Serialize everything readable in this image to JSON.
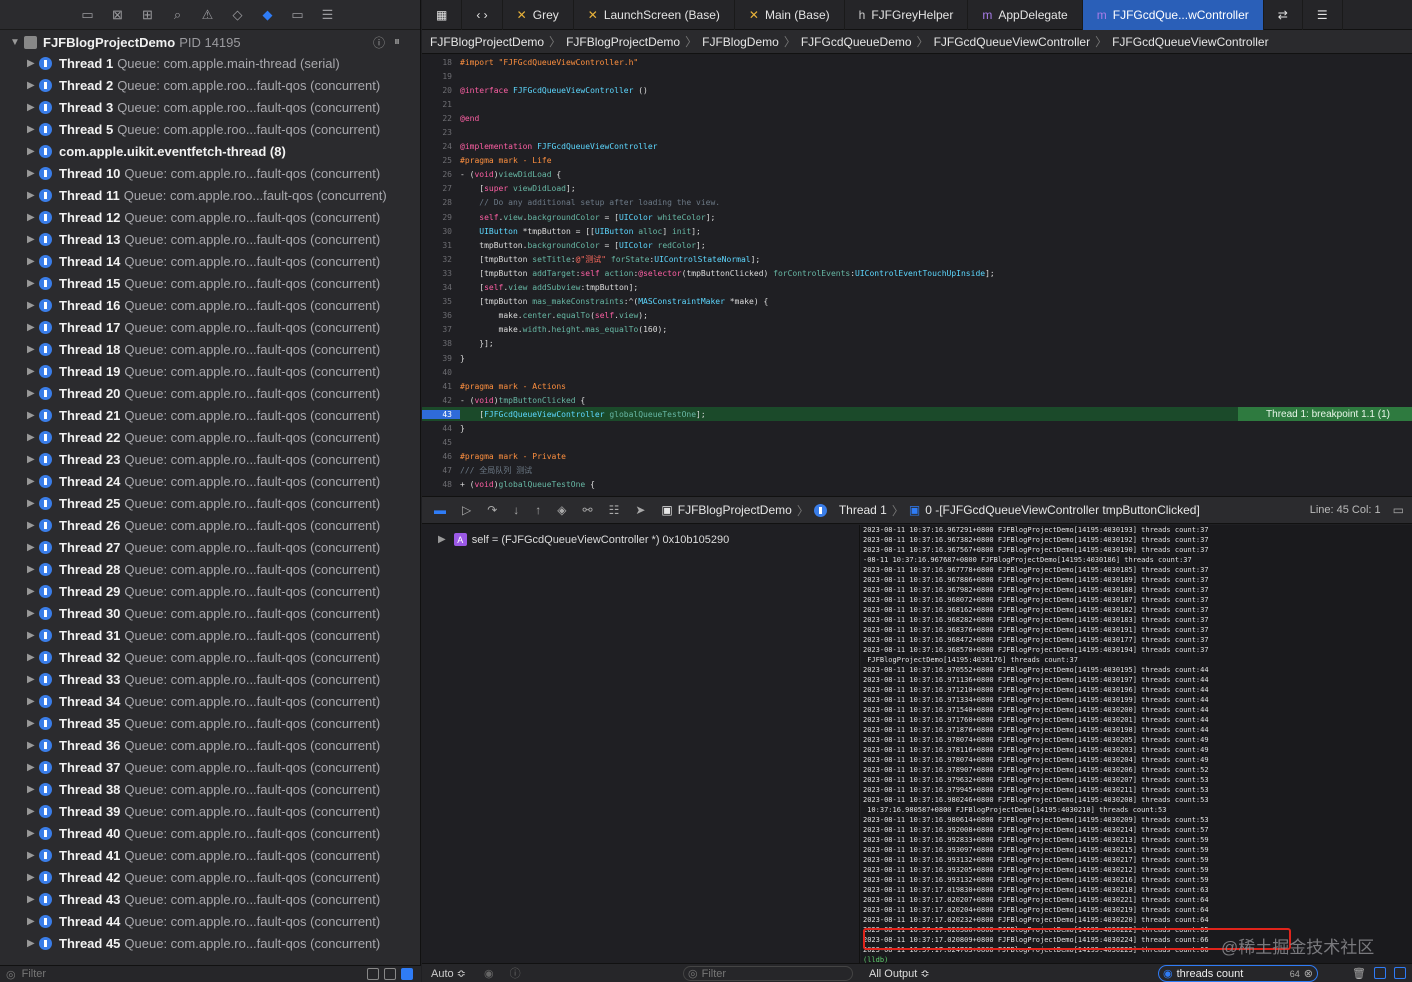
{
  "nav_icons": [
    "folder-icon",
    "xmark-square-icon",
    "hierarchy-icon",
    "search-icon",
    "warning-icon",
    "diamond-icon",
    "debug-navigator-icon",
    "breakpoint-navigator-icon",
    "report-icon"
  ],
  "process": {
    "name": "FJFBlogProjectDemo",
    "pid": "PID 14195"
  },
  "threads": [
    {
      "name": "Thread 1",
      "queue": "Queue: com.apple.main-thread (serial)"
    },
    {
      "name": "Thread 2",
      "queue": "Queue: com.apple.roo...fault-qos (concurrent)"
    },
    {
      "name": "Thread 3",
      "queue": "Queue: com.apple.roo...fault-qos (concurrent)"
    },
    {
      "name": "Thread 5",
      "queue": "Queue: com.apple.roo...fault-qos (concurrent)"
    },
    {
      "name": "com.apple.uikit.eventfetch-thread (8)",
      "queue": ""
    },
    {
      "name": "Thread 10",
      "queue": "Queue: com.apple.ro...fault-qos (concurrent)"
    },
    {
      "name": "Thread 11",
      "queue": "Queue: com.apple.roo...fault-qos (concurrent)"
    },
    {
      "name": "Thread 12",
      "queue": "Queue: com.apple.ro...fault-qos (concurrent)"
    },
    {
      "name": "Thread 13",
      "queue": "Queue: com.apple.ro...fault-qos (concurrent)"
    },
    {
      "name": "Thread 14",
      "queue": "Queue: com.apple.ro...fault-qos (concurrent)"
    },
    {
      "name": "Thread 15",
      "queue": "Queue: com.apple.ro...fault-qos (concurrent)"
    },
    {
      "name": "Thread 16",
      "queue": "Queue: com.apple.ro...fault-qos (concurrent)"
    },
    {
      "name": "Thread 17",
      "queue": "Queue: com.apple.ro...fault-qos (concurrent)"
    },
    {
      "name": "Thread 18",
      "queue": "Queue: com.apple.ro...fault-qos (concurrent)"
    },
    {
      "name": "Thread 19",
      "queue": "Queue: com.apple.ro...fault-qos (concurrent)"
    },
    {
      "name": "Thread 20",
      "queue": "Queue: com.apple.ro...fault-qos (concurrent)"
    },
    {
      "name": "Thread 21",
      "queue": "Queue: com.apple.ro...fault-qos (concurrent)"
    },
    {
      "name": "Thread 22",
      "queue": "Queue: com.apple.ro...fault-qos (concurrent)"
    },
    {
      "name": "Thread 23",
      "queue": "Queue: com.apple.ro...fault-qos (concurrent)"
    },
    {
      "name": "Thread 24",
      "queue": "Queue: com.apple.ro...fault-qos (concurrent)"
    },
    {
      "name": "Thread 25",
      "queue": "Queue: com.apple.ro...fault-qos (concurrent)"
    },
    {
      "name": "Thread 26",
      "queue": "Queue: com.apple.ro...fault-qos (concurrent)"
    },
    {
      "name": "Thread 27",
      "queue": "Queue: com.apple.ro...fault-qos (concurrent)"
    },
    {
      "name": "Thread 28",
      "queue": "Queue: com.apple.ro...fault-qos (concurrent)"
    },
    {
      "name": "Thread 29",
      "queue": "Queue: com.apple.ro...fault-qos (concurrent)"
    },
    {
      "name": "Thread 30",
      "queue": "Queue: com.apple.ro...fault-qos (concurrent)"
    },
    {
      "name": "Thread 31",
      "queue": "Queue: com.apple.ro...fault-qos (concurrent)"
    },
    {
      "name": "Thread 32",
      "queue": "Queue: com.apple.ro...fault-qos (concurrent)"
    },
    {
      "name": "Thread 33",
      "queue": "Queue: com.apple.ro...fault-qos (concurrent)"
    },
    {
      "name": "Thread 34",
      "queue": "Queue: com.apple.ro...fault-qos (concurrent)"
    },
    {
      "name": "Thread 35",
      "queue": "Queue: com.apple.ro...fault-qos (concurrent)"
    },
    {
      "name": "Thread 36",
      "queue": "Queue: com.apple.ro...fault-qos (concurrent)"
    },
    {
      "name": "Thread 37",
      "queue": "Queue: com.apple.ro...fault-qos (concurrent)"
    },
    {
      "name": "Thread 38",
      "queue": "Queue: com.apple.ro...fault-qos (concurrent)"
    },
    {
      "name": "Thread 39",
      "queue": "Queue: com.apple.ro...fault-qos (concurrent)"
    },
    {
      "name": "Thread 40",
      "queue": "Queue: com.apple.ro...fault-qos (concurrent)"
    },
    {
      "name": "Thread 41",
      "queue": "Queue: com.apple.ro...fault-qos (concurrent)"
    },
    {
      "name": "Thread 42",
      "queue": "Queue: com.apple.ro...fault-qos (concurrent)"
    },
    {
      "name": "Thread 43",
      "queue": "Queue: com.apple.ro...fault-qos (concurrent)"
    },
    {
      "name": "Thread 44",
      "queue": "Queue: com.apple.ro...fault-qos (concurrent)"
    },
    {
      "name": "Thread 45",
      "queue": "Queue: com.apple.ro...fault-qos (concurrent)"
    }
  ],
  "left_filter_placeholder": "Filter",
  "tabs": [
    {
      "icon": "✕",
      "label": "Grey",
      "active": false
    },
    {
      "icon": "✕",
      "label": "LaunchScreen (Base)",
      "active": false
    },
    {
      "icon": "✕",
      "label": "Main (Base)",
      "active": false
    },
    {
      "icon": "h",
      "label": "FJFGreyHelper",
      "active": false
    },
    {
      "icon": "m",
      "label": "AppDelegate",
      "active": false
    },
    {
      "icon": "m",
      "label": "FJFGcdQue...wController",
      "active": true
    }
  ],
  "breadcrumb": [
    "FJFBlogProjectDemo",
    "FJFBlogProjectDemo",
    "FJFBlogDemo",
    "FJFGcdQueueDemo",
    "FJFGcdQueueViewController",
    "FJFGcdQueueViewController"
  ],
  "code_lines": [
    {
      "n": "18",
      "html": "<span class='pp'>#import \"FJFGcdQueueViewController.h\"</span>"
    },
    {
      "n": "19",
      "html": ""
    },
    {
      "n": "20",
      "html": "<span class='kw'>@interface</span> <span class='cls'>FJFGcdQueueViewController</span> ()"
    },
    {
      "n": "21",
      "html": ""
    },
    {
      "n": "22",
      "html": "<span class='kw'>@end</span>"
    },
    {
      "n": "23",
      "html": ""
    },
    {
      "n": "24",
      "html": "<span class='kw'>@implementation</span> <span class='cls'>FJFGcdQueueViewController</span>"
    },
    {
      "n": "25",
      "html": "<span class='pp'>#pragma mark - Life</span>"
    },
    {
      "n": "26",
      "html": "- (<span class='kw'>void</span>)<span class='mt'>viewDidLoad</span> {"
    },
    {
      "n": "27",
      "html": "    [<span class='kw'>super</span> <span class='mt'>viewDidLoad</span>];"
    },
    {
      "n": "28",
      "html": "    <span class='cm'>// Do any additional setup after loading the view.</span>"
    },
    {
      "n": "29",
      "html": "    <span class='kw'>self</span>.<span class='mt'>view</span>.<span class='mt'>backgroundColor</span> = [<span class='cls'>UIColor</span> <span class='mt'>whiteColor</span>];"
    },
    {
      "n": "30",
      "html": "    <span class='cls'>UIButton</span> *tmpButton = [[<span class='cls'>UIButton</span> <span class='mt'>alloc</span>] <span class='mt'>init</span>];"
    },
    {
      "n": "31",
      "html": "    tmpButton.<span class='mt'>backgroundColor</span> = [<span class='cls'>UIColor</span> <span class='mt'>redColor</span>];"
    },
    {
      "n": "32",
      "html": "    [tmpButton <span class='mt'>setTitle</span>:<span class='str'>@\"测试\"</span> <span class='mt'>forState</span>:<span class='cls'>UIControlStateNormal</span>];"
    },
    {
      "n": "33",
      "html": "    [tmpButton <span class='mt'>addTarget</span>:<span class='kw'>self</span> <span class='mt'>action</span>:<span class='kw'>@selector</span>(tmpButtonClicked) <span class='mt'>forControlEvents</span>:<span class='cls'>UIControlEventTouchUpInside</span>];"
    },
    {
      "n": "34",
      "html": "    [<span class='kw'>self</span>.<span class='mt'>view</span> <span class='mt'>addSubview</span>:tmpButton];"
    },
    {
      "n": "35",
      "html": "    [tmpButton <span class='mt'>mas_makeConstraints</span>:^(<span class='cls'>MASConstraintMaker</span> *make) {"
    },
    {
      "n": "36",
      "html": "        make.<span class='mt'>center</span>.<span class='mt'>equalTo</span>(<span class='kw'>self</span>.<span class='mt'>view</span>);"
    },
    {
      "n": "37",
      "html": "        make.<span class='mt'>width</span>.<span class='mt'>height</span>.<span class='mt'>mas_equalTo</span>(160);"
    },
    {
      "n": "38",
      "html": "    }];"
    },
    {
      "n": "39",
      "html": "}"
    },
    {
      "n": "40",
      "html": ""
    },
    {
      "n": "41",
      "html": "<span class='pp'>#pragma mark - Actions</span>"
    },
    {
      "n": "42",
      "html": "- (<span class='kw'>void</span>)<span class='mt'>tmpButtonClicked</span> {"
    },
    {
      "n": "43",
      "html": "    [<span class='cls'>FJFGcdQueueViewController</span> <span class='mt'>globalQueueTestOne</span>];",
      "hl": true
    },
    {
      "n": "44",
      "html": "}"
    },
    {
      "n": "45",
      "html": ""
    },
    {
      "n": "46",
      "html": "<span class='pp'>#pragma mark - Private</span>"
    },
    {
      "n": "47",
      "html": "<span class='cm'>/// 全局队列 测试</span>"
    },
    {
      "n": "48",
      "html": "+ (<span class='kw'>void</span>)<span class='mt'>globalQueueTestOne</span> {"
    }
  ],
  "breakpoint_label": "Thread 1: breakpoint 1.1 (1)",
  "debug_bar": {
    "project": "FJFBlogProjectDemo",
    "thread": "Thread 1",
    "frame": "0 -[FJFGcdQueueViewController tmpButtonClicked]",
    "line_col": "Line: 45  Col: 1"
  },
  "variable": {
    "badge": "A",
    "text": "self = (FJFGcdQueueViewController *) 0x10b105290"
  },
  "console_lines": [
    "2023-08-11 10:37:16.967291+0800 FJFBlogProjectDemo[14195:4030193] threads count:37",
    "2023-08-11 10:37:16.967382+0800 FJFBlogProjectDemo[14195:4030192] threads count:37",
    "2023-08-11 10:37:16.967567+0800 FJFBlogProjectDemo[14195:4030190] threads count:37",
    "-08-11 10:37:16.967687+0800 FJFBlogProjectDemo[14195:4030186] threads count:37",
    "2023-08-11 10:37:16.967778+0800 FJFBlogProjectDemo[14195:4030185] threads count:37",
    "2023-08-11 10:37:16.967886+0800 FJFBlogProjectDemo[14195:4030189] threads count:37",
    "2023-08-11 10:37:16.967982+0800 FJFBlogProjectDemo[14195:4030188] threads count:37",
    "2023-08-11 10:37:16.968072+0800 FJFBlogProjectDemo[14195:4030187] threads count:37",
    "2023-08-11 10:37:16.968162+0800 FJFBlogProjectDemo[14195:4030182] threads count:37",
    "2023-08-11 10:37:16.968282+0800 FJFBlogProjectDemo[14195:4030183] threads count:37",
    "2023-08-11 10:37:16.968376+0800 FJFBlogProjectDemo[14195:4030191] threads count:37",
    "2023-08-11 10:37:16.968472+0800 FJFBlogProjectDemo[14195:4030177] threads count:37",
    "2023-08-11 10:37:16.968570+0800 FJFBlogProjectDemo[14195:4030194] threads count:37",
    " FJFBlogProjectDemo[14195:4030176] threads count:37",
    "2023-08-11 10:37:16.970552+0800 FJFBlogProjectDemo[14195:4030195] threads count:44",
    "2023-08-11 10:37:16.971136+0800 FJFBlogProjectDemo[14195:4030197] threads count:44",
    "2023-08-11 10:37:16.971210+0800 FJFBlogProjectDemo[14195:4030196] threads count:44",
    "2023-08-11 10:37:16.971334+0800 FJFBlogProjectDemo[14195:4030199] threads count:44",
    "2023-08-11 10:37:16.971540+0800 FJFBlogProjectDemo[14195:4030200] threads count:44",
    "2023-08-11 10:37:16.971760+0800 FJFBlogProjectDemo[14195:4030201] threads count:44",
    "2023-08-11 10:37:16.971876+0800 FJFBlogProjectDemo[14195:4030198] threads count:44",
    "2023-08-11 10:37:16.978074+0800 FJFBlogProjectDemo[14195:4030205] threads count:49",
    "2023-08-11 10:37:16.978116+0800 FJFBlogProjectDemo[14195:4030203] threads count:49",
    "2023-08-11 10:37:16.978074+0800 FJFBlogProjectDemo[14195:4030204] threads count:49",
    "2023-08-11 10:37:16.978907+0800 FJFBlogProjectDemo[14195:4030206] threads count:52",
    "2023-08-11 10:37:16.979632+0800 FJFBlogProjectDemo[14195:4030207] threads count:53",
    "2023-08-11 10:37:16.979945+0800 FJFBlogProjectDemo[14195:4030211] threads count:53",
    "2023-08-11 10:37:16.980246+0800 FJFBlogProjectDemo[14195:4030208] threads count:53",
    " 10:37:16.980587+0800 FJFBlogProjectDemo[14195:4030210] threads count:53",
    "2023-08-11 10:37:16.980614+0800 FJFBlogProjectDemo[14195:4030209] threads count:53",
    "2023-08-11 10:37:16.992008+0800 FJFBlogProjectDemo[14195:4030214] threads count:57",
    "2023-08-11 10:37:16.992833+0800 FJFBlogProjectDemo[14195:4030213] threads count:59",
    "2023-08-11 10:37:16.993097+0800 FJFBlogProjectDemo[14195:4030215] threads count:59",
    "2023-08-11 10:37:16.993132+0800 FJFBlogProjectDemo[14195:4030217] threads count:59",
    "2023-08-11 10:37:16.993205+0800 FJFBlogProjectDemo[14195:4030212] threads count:59",
    "2023-08-11 10:37:16.993132+0800 FJFBlogProjectDemo[14195:4030216] threads count:59",
    "2023-08-11 10:37:17.019830+0800 FJFBlogProjectDemo[14195:4030218] threads count:63",
    "2023-08-11 10:37:17.020207+0800 FJFBlogProjectDemo[14195:4030221] threads count:64",
    "2023-08-11 10:37:17.020204+0800 FJFBlogProjectDemo[14195:4030219] threads count:64",
    "2023-08-11 10:37:17.020232+0800 FJFBlogProjectDemo[14195:4030220] threads count:64",
    "2023-08-11 10:37:17.020380+0800 FJFBlogProjectDemo[14195:4030222] threads count:65",
    "2023-08-11 10:37:17.020809+0800 FJFBlogProjectDemo[14195:4030224] threads count:66",
    "2023-08-11 10:37:17.024763+0800 FJFBlogProjectDemo[14195:4030223] threads count:66"
  ],
  "lldb_prompt": "(lldb)",
  "watermark": "@稀土掘金技术社区",
  "bottom": {
    "auto_label": "Auto ≎",
    "var_filter_placeholder": "Filter",
    "output_label": "All Output ≎",
    "console_filter_value": "threads count",
    "match_count": "64"
  },
  "colors": {
    "accent": "#2f7cf6",
    "breakpoint_green": "#2e7a3f",
    "highlight_red": "#e0241b"
  }
}
